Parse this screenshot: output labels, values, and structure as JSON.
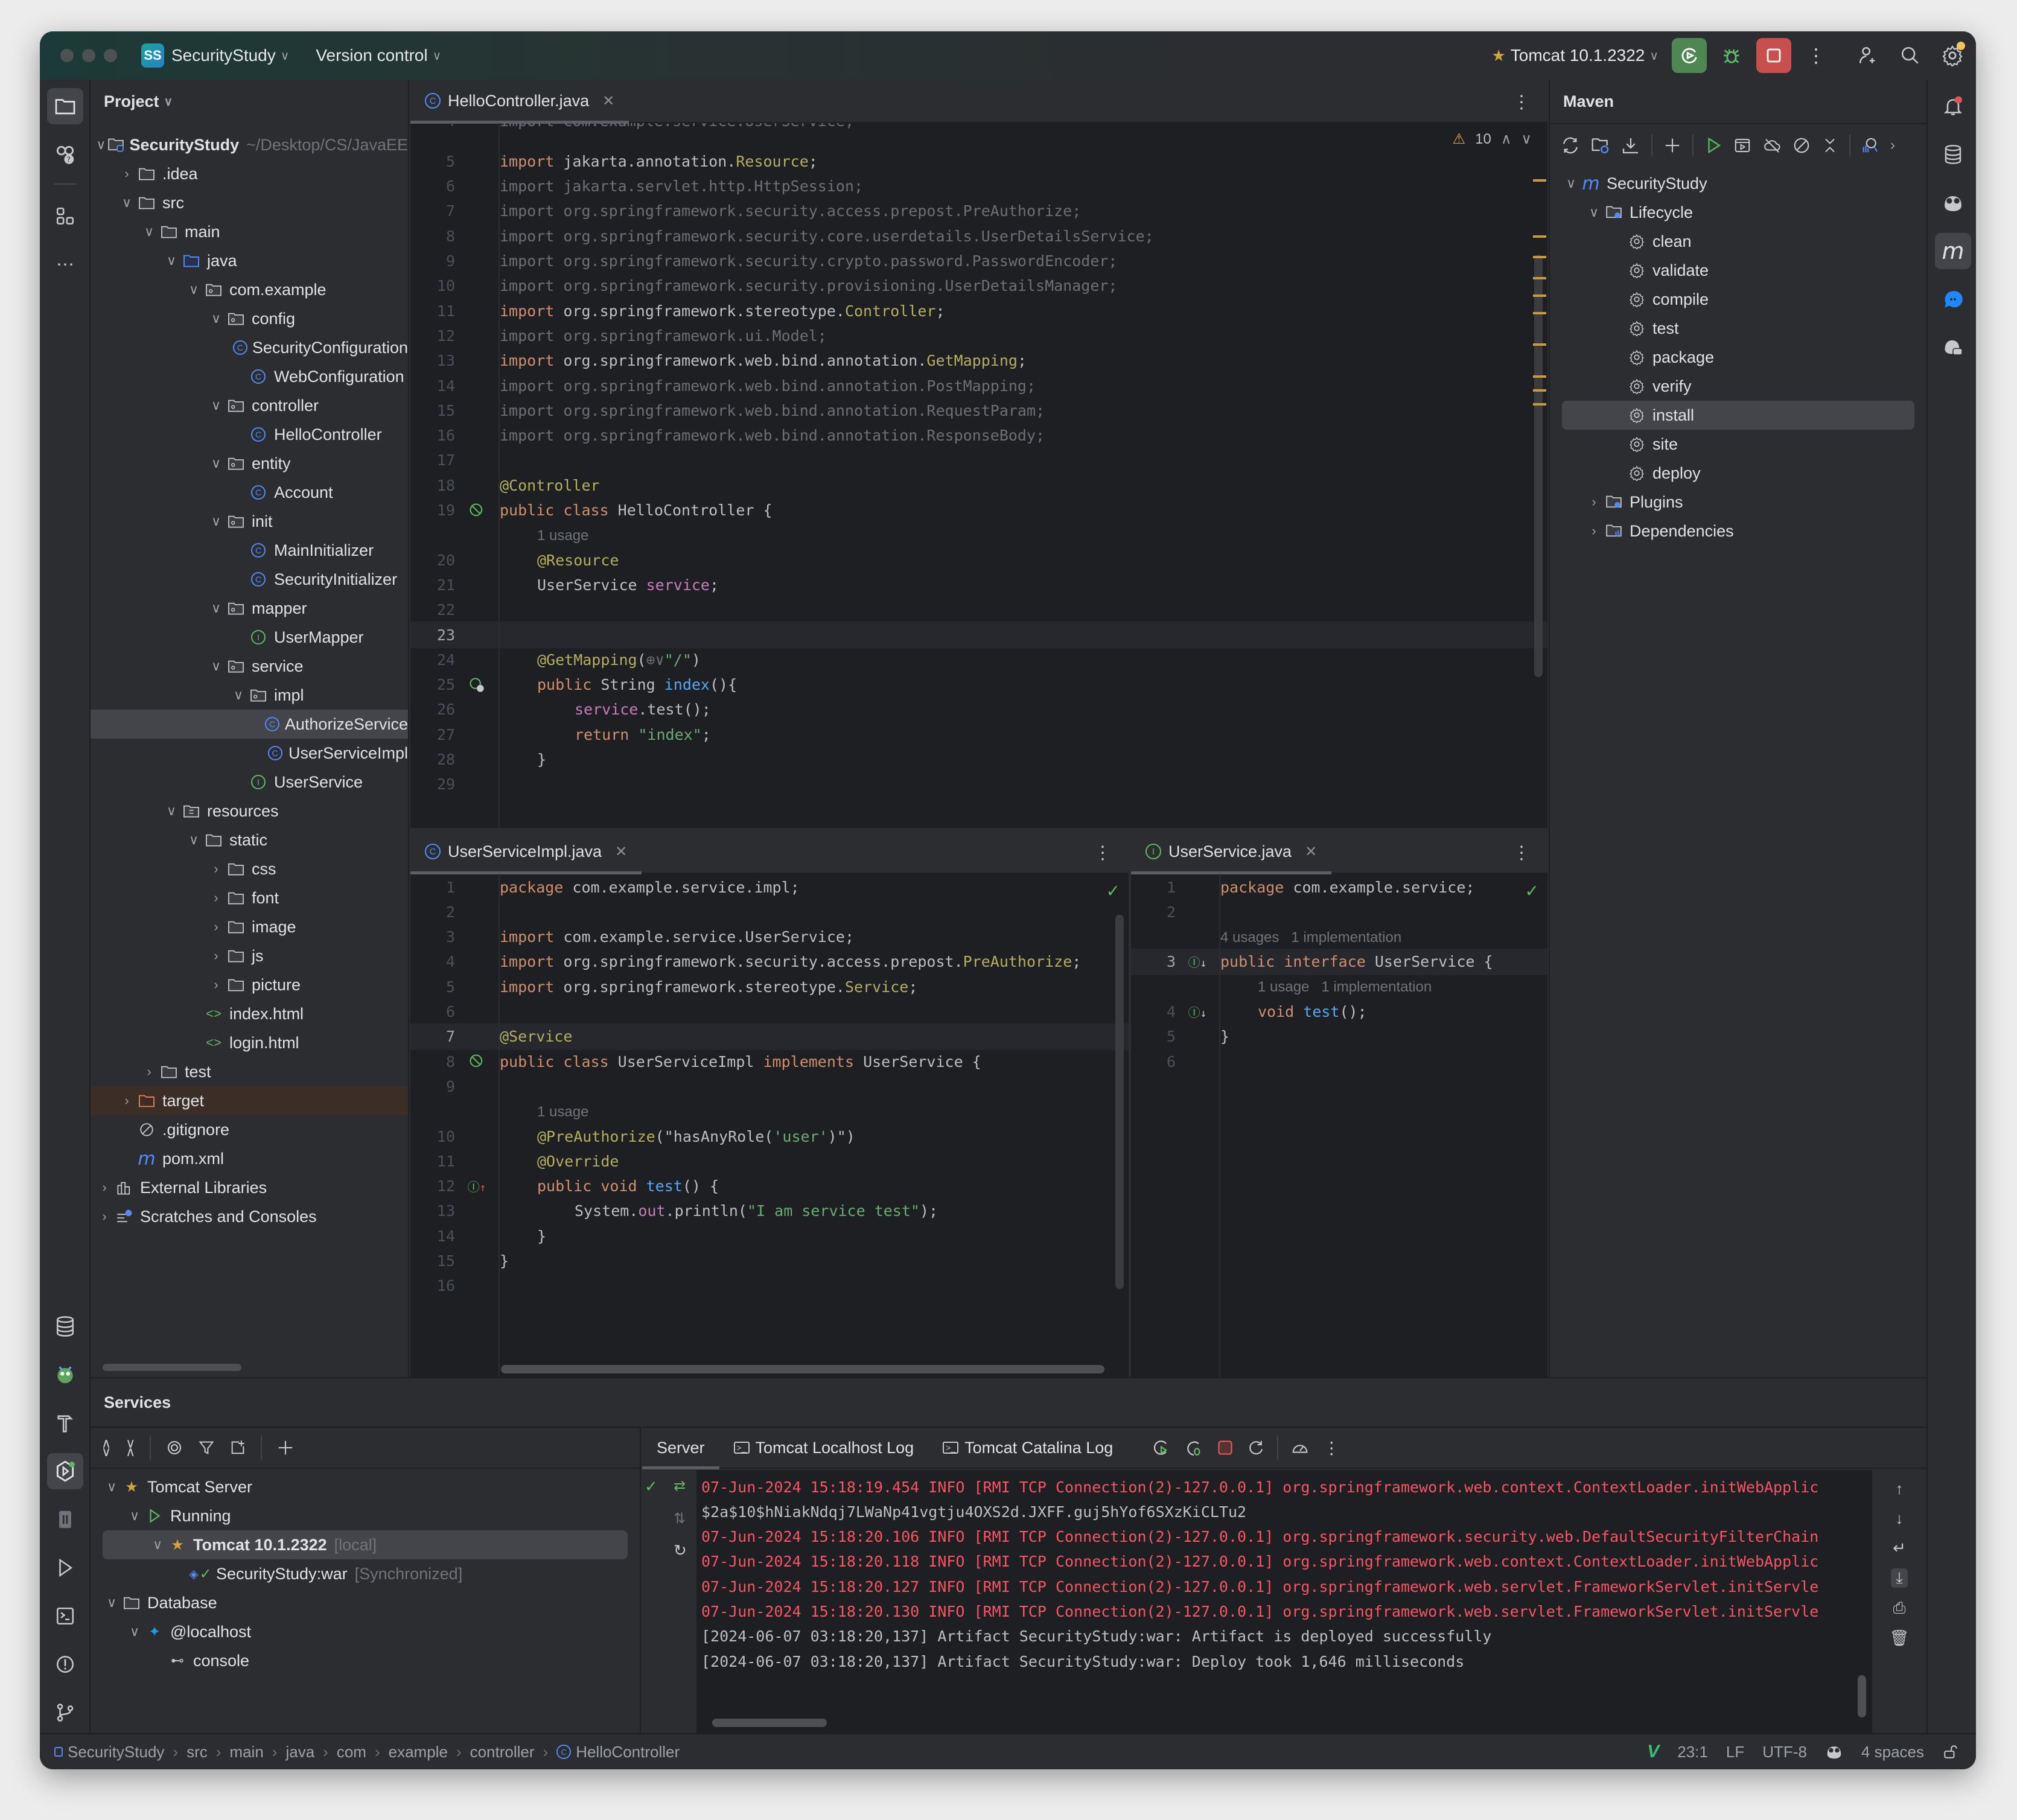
{
  "titlebar": {
    "project_badge": "SS",
    "project_name": "SecurityStudy",
    "vcs_label": "Version control",
    "run_config": "Tomcat 10.1.2322"
  },
  "project_panel": {
    "title": "Project",
    "tree": [
      {
        "label": "SecurityStudy",
        "suffix": "~/Desktop/CS/JavaEE",
        "depth": 0,
        "expanded": true,
        "icon": "module-folder-icon",
        "bold": true
      },
      {
        "label": ".idea",
        "depth": 1,
        "expanded": false,
        "icon": "folder-icon"
      },
      {
        "label": "src",
        "depth": 1,
        "expanded": true,
        "icon": "folder-icon"
      },
      {
        "label": "main",
        "depth": 2,
        "expanded": true,
        "icon": "folder-icon"
      },
      {
        "label": "java",
        "depth": 3,
        "expanded": true,
        "icon": "source-folder-icon"
      },
      {
        "label": "com.example",
        "depth": 4,
        "expanded": true,
        "icon": "package-icon"
      },
      {
        "label": "config",
        "depth": 5,
        "expanded": true,
        "icon": "package-icon"
      },
      {
        "label": "SecurityConfiguration",
        "depth": 6,
        "icon": "class-icon"
      },
      {
        "label": "WebConfiguration",
        "depth": 6,
        "icon": "class-icon"
      },
      {
        "label": "controller",
        "depth": 5,
        "expanded": true,
        "icon": "package-icon"
      },
      {
        "label": "HelloController",
        "depth": 6,
        "icon": "class-icon"
      },
      {
        "label": "entity",
        "depth": 5,
        "expanded": true,
        "icon": "package-icon"
      },
      {
        "label": "Account",
        "depth": 6,
        "icon": "class-icon"
      },
      {
        "label": "init",
        "depth": 5,
        "expanded": true,
        "icon": "package-icon"
      },
      {
        "label": "MainInitializer",
        "depth": 6,
        "icon": "class-icon"
      },
      {
        "label": "SecurityInitializer",
        "depth": 6,
        "icon": "class-icon"
      },
      {
        "label": "mapper",
        "depth": 5,
        "expanded": true,
        "icon": "package-icon"
      },
      {
        "label": "UserMapper",
        "depth": 6,
        "icon": "interface-icon"
      },
      {
        "label": "service",
        "depth": 5,
        "expanded": true,
        "icon": "package-icon"
      },
      {
        "label": "impl",
        "depth": 6,
        "expanded": true,
        "icon": "package-icon"
      },
      {
        "label": "AuthorizeService",
        "depth": 7,
        "icon": "class-icon",
        "selected": true
      },
      {
        "label": "UserServiceImpl",
        "depth": 7,
        "icon": "class-icon"
      },
      {
        "label": "UserService",
        "depth": 6,
        "icon": "interface-icon"
      },
      {
        "label": "resources",
        "depth": 3,
        "expanded": true,
        "icon": "resources-folder-icon"
      },
      {
        "label": "static",
        "depth": 4,
        "expanded": true,
        "icon": "folder-icon"
      },
      {
        "label": "css",
        "depth": 5,
        "expanded": false,
        "icon": "folder-icon"
      },
      {
        "label": "font",
        "depth": 5,
        "expanded": false,
        "icon": "folder-icon"
      },
      {
        "label": "image",
        "depth": 5,
        "expanded": false,
        "icon": "folder-icon"
      },
      {
        "label": "js",
        "depth": 5,
        "expanded": false,
        "icon": "folder-icon"
      },
      {
        "label": "picture",
        "depth": 5,
        "expanded": false,
        "icon": "folder-icon"
      },
      {
        "label": "index.html",
        "depth": 4,
        "icon": "html-file-icon"
      },
      {
        "label": "login.html",
        "depth": 4,
        "icon": "html-file-icon"
      },
      {
        "label": "test",
        "depth": 2,
        "expanded": false,
        "icon": "folder-icon"
      },
      {
        "label": "target",
        "depth": 1,
        "expanded": false,
        "icon": "excluded-folder-icon",
        "excluded": true
      },
      {
        "label": ".gitignore",
        "depth": 1,
        "icon": "ignore-file-icon"
      },
      {
        "label": "pom.xml",
        "depth": 1,
        "icon": "maven-file-icon"
      },
      {
        "label": "External Libraries",
        "depth": 0,
        "expanded": false,
        "icon": "library-icon"
      },
      {
        "label": "Scratches and Consoles",
        "depth": 0,
        "expanded": false,
        "icon": "scratches-icon"
      }
    ]
  },
  "editor_main": {
    "tab": "HelloController.java",
    "warnings": "10",
    "lines": [
      {
        "n": "4",
        "tokens": [
          [
            "dim",
            "import com.example.service.UserService;"
          ]
        ],
        "clipped": true
      },
      {
        "n": "5",
        "tokens": [
          [
            "kw",
            "import "
          ],
          [
            "typ",
            "jakarta.annotation."
          ],
          [
            "an",
            "Resource"
          ],
          [
            "typ",
            ";"
          ]
        ]
      },
      {
        "n": "6",
        "tokens": [
          [
            "dim",
            "import jakarta.servlet.http.HttpSession;"
          ]
        ]
      },
      {
        "n": "7",
        "tokens": [
          [
            "dim",
            "import org.springframework.security.access.prepost.PreAuthorize;"
          ]
        ]
      },
      {
        "n": "8",
        "tokens": [
          [
            "dim",
            "import org.springframework.security.core.userdetails.UserDetailsService;"
          ]
        ]
      },
      {
        "n": "9",
        "tokens": [
          [
            "dim",
            "import org.springframework.security.crypto.password.PasswordEncoder;"
          ]
        ]
      },
      {
        "n": "10",
        "tokens": [
          [
            "dim",
            "import org.springframework.security.provisioning.UserDetailsManager;"
          ]
        ]
      },
      {
        "n": "11",
        "tokens": [
          [
            "kw",
            "import "
          ],
          [
            "typ",
            "org.springframework.stereotype."
          ],
          [
            "an",
            "Controller"
          ],
          [
            "typ",
            ";"
          ]
        ]
      },
      {
        "n": "12",
        "tokens": [
          [
            "dim",
            "import org.springframework.ui.Model;"
          ]
        ]
      },
      {
        "n": "13",
        "tokens": [
          [
            "kw",
            "import "
          ],
          [
            "typ",
            "org.springframework.web.bind.annotation."
          ],
          [
            "an",
            "GetMapping"
          ],
          [
            "typ",
            ";"
          ]
        ]
      },
      {
        "n": "14",
        "tokens": [
          [
            "dim",
            "import org.springframework.web.bind.annotation.PostMapping;"
          ]
        ]
      },
      {
        "n": "15",
        "tokens": [
          [
            "dim",
            "import org.springframework.web.bind.annotation.RequestParam;"
          ]
        ]
      },
      {
        "n": "16",
        "tokens": [
          [
            "dim",
            "import org.springframework.web.bind.annotation.ResponseBody;"
          ]
        ]
      },
      {
        "n": "17",
        "tokens": []
      },
      {
        "n": "18",
        "tokens": [
          [
            "an",
            "@Controller"
          ]
        ]
      },
      {
        "n": "19",
        "tokens": [
          [
            "kw",
            "public class "
          ],
          [
            "typ",
            "HelloController {"
          ]
        ],
        "gutter": "bean-icon"
      },
      {
        "n": "",
        "hint": "1 usage",
        "indent": 1
      },
      {
        "n": "20",
        "tokens": [
          [
            "an",
            "@Resource"
          ]
        ],
        "indent": 1
      },
      {
        "n": "21",
        "tokens": [
          [
            "typ",
            "UserService "
          ],
          [
            "fld",
            "service"
          ],
          [
            "typ",
            ";"
          ]
        ],
        "indent": 1
      },
      {
        "n": "22",
        "tokens": []
      },
      {
        "n": "23",
        "tokens": [],
        "current": true
      },
      {
        "n": "24",
        "tokens": [
          [
            "an",
            "@GetMapping"
          ],
          [
            "typ",
            "("
          ],
          [
            "dim",
            "⊕∨"
          ],
          [
            "str",
            "\"/\""
          ],
          [
            "typ",
            ")"
          ]
        ],
        "indent": 1
      },
      {
        "n": "25",
        "tokens": [
          [
            "kw",
            "public "
          ],
          [
            "typ",
            "String "
          ],
          [
            "fn",
            "index"
          ],
          [
            "typ",
            "(){"
          ]
        ],
        "indent": 1,
        "gutter": "web-endpoint-icon"
      },
      {
        "n": "26",
        "tokens": [
          [
            "fld",
            "service"
          ],
          [
            "typ",
            ".test();"
          ]
        ],
        "indent": 2
      },
      {
        "n": "27",
        "tokens": [
          [
            "kw",
            "return "
          ],
          [
            "str",
            "\"index\""
          ],
          [
            "typ",
            ";"
          ]
        ],
        "indent": 2
      },
      {
        "n": "28",
        "tokens": [
          [
            "typ",
            "}"
          ]
        ],
        "indent": 1
      },
      {
        "n": "29",
        "tokens": []
      }
    ]
  },
  "editor_left": {
    "tab": "UserServiceImpl.java",
    "lines": [
      {
        "n": "1",
        "tokens": [
          [
            "kw",
            "package "
          ],
          [
            "typ",
            "com.example.service.impl;"
          ]
        ]
      },
      {
        "n": "2",
        "tokens": []
      },
      {
        "n": "3",
        "tokens": [
          [
            "kw",
            "import "
          ],
          [
            "typ",
            "com.example.service.UserService;"
          ]
        ]
      },
      {
        "n": "4",
        "tokens": [
          [
            "kw",
            "import "
          ],
          [
            "typ",
            "org.springframework.security.access.prepost."
          ],
          [
            "an",
            "PreAuthorize"
          ],
          [
            "typ",
            ";"
          ]
        ]
      },
      {
        "n": "5",
        "tokens": [
          [
            "kw",
            "import "
          ],
          [
            "typ",
            "org.springframework.stereotype."
          ],
          [
            "an",
            "Service"
          ],
          [
            "typ",
            ";"
          ]
        ]
      },
      {
        "n": "6",
        "tokens": []
      },
      {
        "n": "7",
        "tokens": [
          [
            "an",
            "@Service"
          ]
        ],
        "current": true
      },
      {
        "n": "8",
        "tokens": [
          [
            "kw",
            "public class "
          ],
          [
            "typ",
            "UserServiceImpl "
          ],
          [
            "kw",
            "implements "
          ],
          [
            "typ",
            "UserService {"
          ]
        ],
        "gutter": "bean-icon"
      },
      {
        "n": "9",
        "tokens": []
      },
      {
        "n": "",
        "hint": "1 usage",
        "indent": 1
      },
      {
        "n": "10",
        "tokens": [
          [
            "an",
            "@PreAuthorize"
          ],
          [
            "typ",
            "(\""
          ],
          [
            "typ",
            "hasAnyRole("
          ],
          [
            "str",
            "'user'"
          ],
          [
            "typ",
            ")"
          ],
          [
            "typ",
            "\")"
          ]
        ],
        "indent": 1
      },
      {
        "n": "11",
        "tokens": [
          [
            "an",
            "@Override"
          ]
        ],
        "indent": 1
      },
      {
        "n": "12",
        "tokens": [
          [
            "kw",
            "public void "
          ],
          [
            "fn",
            "test"
          ],
          [
            "typ",
            "() {"
          ]
        ],
        "indent": 1,
        "gutter": "implements-icon"
      },
      {
        "n": "13",
        "tokens": [
          [
            "typ",
            "System."
          ],
          [
            "fld",
            "out"
          ],
          [
            "typ",
            ".println("
          ],
          [
            "str",
            "\"I am service test\""
          ],
          [
            "typ",
            ");"
          ]
        ],
        "indent": 2
      },
      {
        "n": "14",
        "tokens": [
          [
            "typ",
            "}"
          ]
        ],
        "indent": 1
      },
      {
        "n": "15",
        "tokens": [
          [
            "typ",
            "}"
          ]
        ]
      },
      {
        "n": "16",
        "tokens": []
      }
    ]
  },
  "editor_right": {
    "tab": "UserService.java",
    "lines": [
      {
        "n": "1",
        "tokens": [
          [
            "kw",
            "package "
          ],
          [
            "typ",
            "com.example.service;"
          ]
        ]
      },
      {
        "n": "2",
        "tokens": []
      },
      {
        "n": "",
        "hint": "4 usages   1 implementation"
      },
      {
        "n": "3",
        "tokens": [
          [
            "kw",
            "public interface "
          ],
          [
            "typ",
            "UserService {"
          ]
        ],
        "current": true,
        "gutter": "implemented-icon"
      },
      {
        "n": "",
        "hint": "1 usage   1 implementation",
        "indent": 1
      },
      {
        "n": "4",
        "tokens": [
          [
            "kw",
            "void "
          ],
          [
            "fn",
            "test"
          ],
          [
            "typ",
            "();"
          ]
        ],
        "indent": 1,
        "gutter": "implemented-icon"
      },
      {
        "n": "5",
        "tokens": [
          [
            "typ",
            "}"
          ]
        ]
      },
      {
        "n": "6",
        "tokens": []
      }
    ]
  },
  "maven": {
    "title": "Maven",
    "project": "SecurityStudy",
    "lifecycle_label": "Lifecycle",
    "goals": [
      "clean",
      "validate",
      "compile",
      "test",
      "package",
      "verify",
      "install",
      "site",
      "deploy"
    ],
    "selected_goal": "install",
    "plugins_label": "Plugins",
    "dependencies_label": "Dependencies"
  },
  "services": {
    "title": "Services",
    "tree": [
      {
        "label": "Tomcat Server",
        "depth": 0,
        "icon": "tomcat-icon"
      },
      {
        "label": "Running",
        "depth": 1,
        "icon": "run-icon"
      },
      {
        "label": "Tomcat 10.1.2322",
        "suffix": "[local]",
        "depth": 2,
        "icon": "tomcat-running-icon",
        "selected": true,
        "bold": true
      },
      {
        "label": "SecurityStudy:war",
        "suffix": "[Synchronized]",
        "depth": 3,
        "icon": "artifact-icon"
      },
      {
        "label": "Database",
        "depth": 0,
        "icon": "folder-icon"
      },
      {
        "label": "@localhost",
        "depth": 1,
        "icon": "mysql-icon"
      },
      {
        "label": "console",
        "depth": 2,
        "icon": "console-icon"
      }
    ],
    "output_tabs": [
      "Server",
      "Tomcat Localhost Log",
      "Tomcat Catalina Log"
    ],
    "log": [
      {
        "color": "red",
        "text": "07-Jun-2024 15:18:19.454 INFO [RMI TCP Connection(2)-127.0.0.1] org.springframework.web.context.ContextLoader.initWebApplic"
      },
      {
        "color": "gray",
        "text": "$2a$10$hNiakNdqj7LWaNp41vgtju4OXS2d.JXFF.guj5hYof6SXzKiCLTu2"
      },
      {
        "color": "red",
        "text": "07-Jun-2024 15:18:20.106 INFO [RMI TCP Connection(2)-127.0.0.1] org.springframework.security.web.DefaultSecurityFilterChain"
      },
      {
        "color": "red",
        "text": "07-Jun-2024 15:18:20.118 INFO [RMI TCP Connection(2)-127.0.0.1] org.springframework.web.context.ContextLoader.initWebApplic"
      },
      {
        "color": "red",
        "text": "07-Jun-2024 15:18:20.127 INFO [RMI TCP Connection(2)-127.0.0.1] org.springframework.web.servlet.FrameworkServlet.initServle"
      },
      {
        "color": "red",
        "text": "07-Jun-2024 15:18:20.130 INFO [RMI TCP Connection(2)-127.0.0.1] org.springframework.web.servlet.FrameworkServlet.initServle"
      },
      {
        "color": "gray",
        "text": "[2024-06-07 03:18:20,137] Artifact SecurityStudy:war: Artifact is deployed successfully"
      },
      {
        "color": "gray",
        "text": "[2024-06-07 03:18:20,137] Artifact SecurityStudy:war: Deploy took 1,646 milliseconds"
      }
    ]
  },
  "statusbar": {
    "breadcrumb": [
      "SecurityStudy",
      "src",
      "main",
      "java",
      "com",
      "example",
      "controller",
      "HelloController"
    ],
    "position": "23:1",
    "line_sep": "LF",
    "encoding": "UTF-8",
    "indent": "4 spaces"
  },
  "colors": {
    "accent_green": "#4e8752",
    "stop_red": "#c94f4f",
    "log_red": "#f75464",
    "selection": "#43454a"
  }
}
